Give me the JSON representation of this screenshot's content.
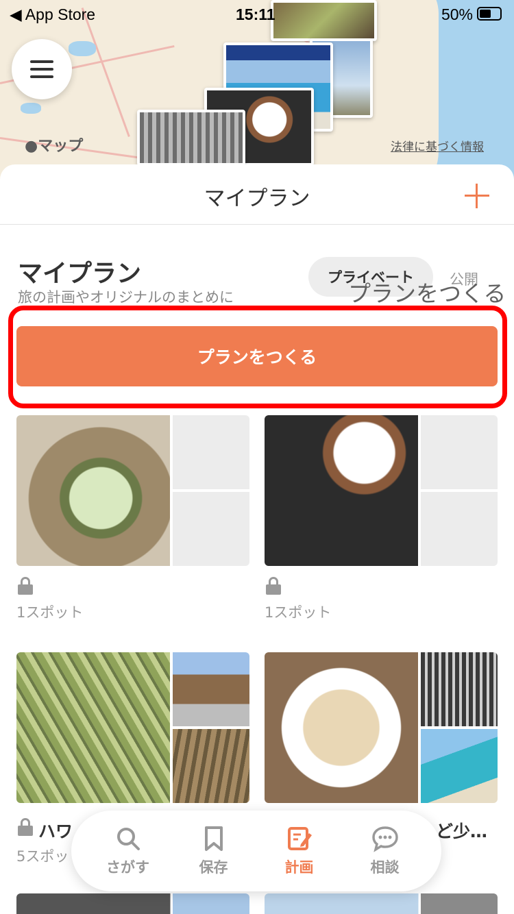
{
  "status_bar": {
    "back_app": "◀ App Store",
    "time": "15:11",
    "battery": "50%"
  },
  "map": {
    "brand": "マップ",
    "legal_link": "法律に基づく情報"
  },
  "header": {
    "title": "マイプラン"
  },
  "section": {
    "title": "マイプラン",
    "subtitle": "旅の計画やオリジナルのまとめに",
    "tab_private": "プライベート",
    "tab_public": "公開",
    "overlay_label": "プランをつくる",
    "create_button": "プランをつくる"
  },
  "plans": [
    {
      "spots": "1スポット",
      "name": ""
    },
    {
      "spots": "1スポット",
      "name": ""
    },
    {
      "spots": "5スポッ",
      "name": "ハワ"
    },
    {
      "spots": "",
      "name": "ど少…"
    }
  ],
  "tabbar": {
    "items": [
      {
        "label": "さがす",
        "icon": "search-icon"
      },
      {
        "label": "保存",
        "icon": "bookmark-icon"
      },
      {
        "label": "計画",
        "icon": "plan-edit-icon",
        "active": true
      },
      {
        "label": "相談",
        "icon": "chat-bubble-icon"
      }
    ]
  },
  "colors": {
    "accent": "#f07c50",
    "highlight": "#ff0000"
  }
}
